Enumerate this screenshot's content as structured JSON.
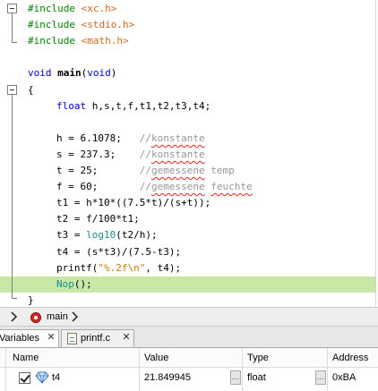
{
  "editor": {
    "lines": [
      {
        "kind": "include",
        "directive": "#include",
        "header": "<xc.h>"
      },
      {
        "kind": "include",
        "directive": "#include",
        "header": "<stdio.h>"
      },
      {
        "kind": "include",
        "directive": "#include",
        "header": "<math.h>"
      },
      {
        "kind": "blank"
      },
      {
        "kind": "func",
        "ret": "void",
        "name": "main",
        "open": "(",
        "param": "void",
        "close": ")"
      },
      {
        "kind": "brace",
        "text": "{"
      },
      {
        "kind": "decl",
        "type": "float",
        "rest": " h,s,t,f,t1,t2,t3,t4;"
      },
      {
        "kind": "blank"
      },
      {
        "kind": "assign",
        "lhs": "h = ",
        "num": "6.1078",
        "end": ";",
        "pad": "   ",
        "comment_prefix": "//",
        "comment_words": [
          {
            "t": "konstante",
            "sq": true
          }
        ]
      },
      {
        "kind": "assign",
        "lhs": "s = ",
        "num": "237.3",
        "end": ";",
        "pad": "    ",
        "comment_prefix": "//",
        "comment_words": [
          {
            "t": "konstante",
            "sq": true
          }
        ]
      },
      {
        "kind": "assign",
        "lhs": "t = ",
        "num": "25",
        "end": ";",
        "pad": "       ",
        "comment_prefix": "//",
        "comment_words": [
          {
            "t": "gemessene",
            "sq": true
          },
          {
            "t": " temp",
            "sq": false
          }
        ]
      },
      {
        "kind": "assign",
        "lhs": "f = ",
        "num": "60",
        "end": ";",
        "pad": "       ",
        "comment_prefix": "//",
        "comment_words": [
          {
            "t": "gemessene",
            "sq": true
          },
          {
            "t": " ",
            "sq": false
          },
          {
            "t": "feuchte",
            "sq": true
          }
        ]
      },
      {
        "kind": "plain",
        "text": "t1 = h*10*((7.5*t)/(s+t));"
      },
      {
        "kind": "plain",
        "text": "t2 = f/100*t1;"
      },
      {
        "kind": "call",
        "pre": "t3 = ",
        "fn": "log10",
        "post": "(t2/h);"
      },
      {
        "kind": "plain",
        "text": "t4 = (s*t3)/(7.5-t3);"
      },
      {
        "kind": "printf",
        "fn": "printf",
        "open": "(",
        "str": "\"%.2f\\n\"",
        "post": ", t4);"
      },
      {
        "kind": "nop",
        "fn": "Nop",
        "post": "();",
        "current": true
      },
      {
        "kind": "brace",
        "text": "}"
      }
    ]
  },
  "breadcrumb": {
    "function": "main"
  },
  "tabs": [
    {
      "label": "Variables",
      "active": true
    },
    {
      "label": "printf.c",
      "active": false
    }
  ],
  "variables": {
    "headers": {
      "name": "Name",
      "value": "Value",
      "type": "Type",
      "address": "Address"
    },
    "rows": [
      {
        "name": "t4",
        "value": "21.849945",
        "type": "float",
        "address": "0xBA",
        "checked": true
      }
    ]
  },
  "colors": {
    "current_line": "#c8e8a8",
    "keyword": "#0000e6",
    "preprocessor": "#008000",
    "include_header": "#d2691e",
    "string": "#ce7b00",
    "comment": "#969696",
    "builtin_call": "#1c8c8c"
  },
  "icons": {
    "breadcrumb_function": "function-breakpoint-icon",
    "variable": "watch-diamond-icon",
    "file": "c-source-file-icon"
  }
}
